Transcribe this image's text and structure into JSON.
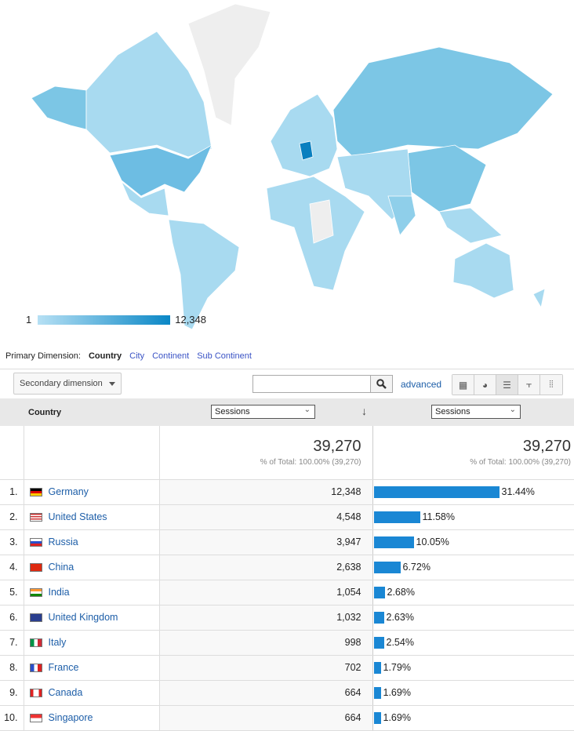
{
  "map": {
    "legend_min": "1",
    "legend_max": "12,348",
    "colors": {
      "low": "#b6e0f4",
      "high": "#0a87c6",
      "nodata": "#eeeeee"
    }
  },
  "dimension": {
    "label": "Primary Dimension:",
    "options": [
      {
        "label": "Country",
        "active": true
      },
      {
        "label": "City"
      },
      {
        "label": "Continent"
      },
      {
        "label": "Sub Continent"
      }
    ]
  },
  "toolbar": {
    "secondary_dimension": "Secondary dimension",
    "search_value": "",
    "advanced": "advanced",
    "views": [
      "grid-icon",
      "pie-icon",
      "bar-icon",
      "comparison-icon",
      "pivot-icon"
    ]
  },
  "table": {
    "col_country": "Country",
    "metric1": "Sessions",
    "metric2": "Sessions",
    "totals": {
      "value1": "39,270",
      "pct1": "% of Total: 100.00% (39,270)",
      "value2": "39,270",
      "pct2": "% of Total: 100.00% (39,270)"
    },
    "rows": [
      {
        "rank": "1.",
        "country": "Germany",
        "flag": "de",
        "sessions": "12,348",
        "pct": "31.44%",
        "pct_value": 31.44
      },
      {
        "rank": "2.",
        "country": "United States",
        "flag": "us",
        "sessions": "4,548",
        "pct": "11.58%",
        "pct_value": 11.58
      },
      {
        "rank": "3.",
        "country": "Russia",
        "flag": "ru",
        "sessions": "3,947",
        "pct": "10.05%",
        "pct_value": 10.05
      },
      {
        "rank": "4.",
        "country": "China",
        "flag": "cn",
        "sessions": "2,638",
        "pct": "6.72%",
        "pct_value": 6.72
      },
      {
        "rank": "5.",
        "country": "India",
        "flag": "in",
        "sessions": "1,054",
        "pct": "2.68%",
        "pct_value": 2.68
      },
      {
        "rank": "6.",
        "country": "United Kingdom",
        "flag": "gb",
        "sessions": "1,032",
        "pct": "2.63%",
        "pct_value": 2.63
      },
      {
        "rank": "7.",
        "country": "Italy",
        "flag": "it",
        "sessions": "998",
        "pct": "2.54%",
        "pct_value": 2.54
      },
      {
        "rank": "8.",
        "country": "France",
        "flag": "fr",
        "sessions": "702",
        "pct": "1.79%",
        "pct_value": 1.79
      },
      {
        "rank": "9.",
        "country": "Canada",
        "flag": "ca",
        "sessions": "664",
        "pct": "1.69%",
        "pct_value": 1.69
      },
      {
        "rank": "10.",
        "country": "Singapore",
        "flag": "sg",
        "sessions": "664",
        "pct": "1.69%",
        "pct_value": 1.69
      }
    ]
  }
}
